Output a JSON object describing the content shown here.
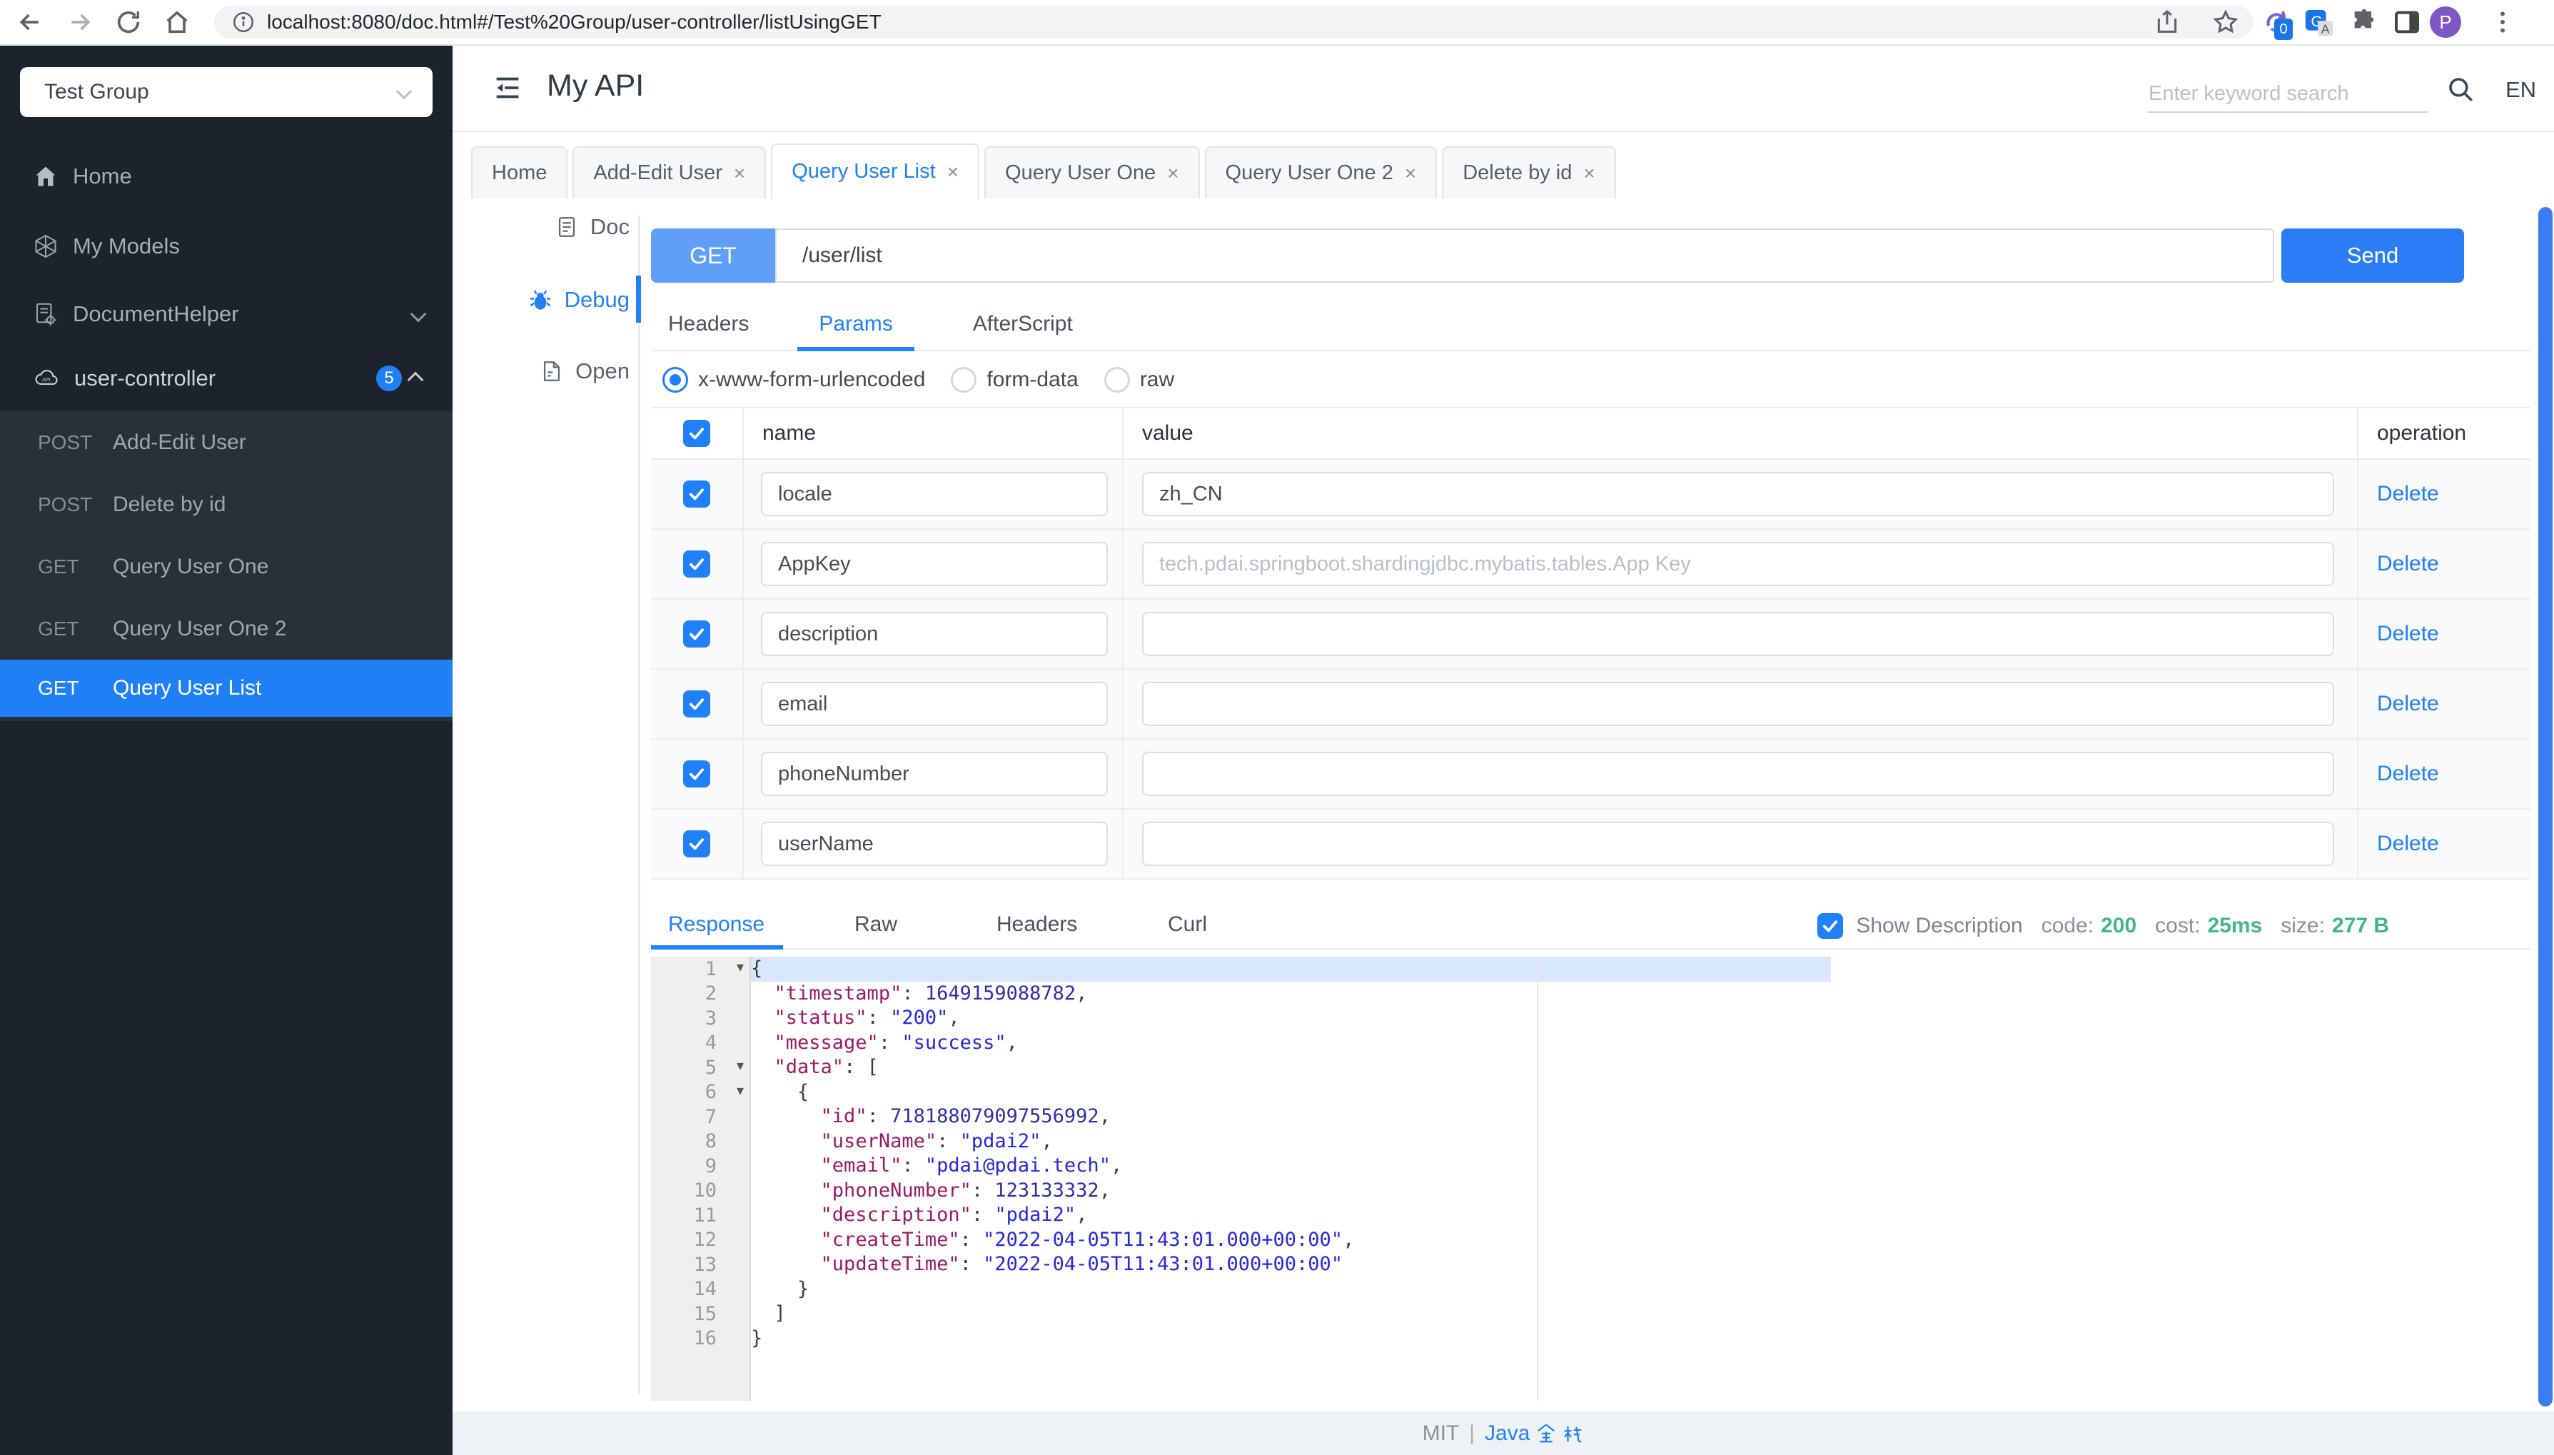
{
  "colors": {
    "accent": "#2080f7",
    "method_chip": "#5f9ff8",
    "success_green": "#42b983",
    "sidebar_bg": "#1c232d",
    "submenu_bg": "#28303a",
    "selected_item": "#1f7ff5",
    "json_key": "#991a66",
    "json_string": "#2727e0",
    "json_number": "#2f2fa8"
  },
  "browser": {
    "url": "localhost:8080/doc.html#/Test%20Group/user-controller/listUsingGET",
    "extension_badge": "0",
    "avatar_initial": "P"
  },
  "sidebar": {
    "group_select": {
      "value": "Test Group"
    },
    "items": [
      {
        "label": "Home"
      },
      {
        "label": "My Models"
      },
      {
        "label": "DocumentHelper"
      }
    ],
    "controller": {
      "label": "user-controller",
      "badge": "5"
    },
    "endpoints": [
      {
        "method": "POST",
        "label": "Add-Edit User",
        "active": false
      },
      {
        "method": "POST",
        "label": "Delete by id",
        "active": false
      },
      {
        "method": "GET",
        "label": "Query User One",
        "active": false
      },
      {
        "method": "GET",
        "label": "Query User One 2",
        "active": false
      },
      {
        "method": "GET",
        "label": "Query User List",
        "active": true
      }
    ]
  },
  "header": {
    "title": "My API",
    "search_placeholder": "Enter keyword search",
    "lang": "EN"
  },
  "tabs": [
    {
      "label": "Home",
      "closable": false,
      "active": false
    },
    {
      "label": "Add-Edit User",
      "closable": true,
      "active": false
    },
    {
      "label": "Query User List",
      "closable": true,
      "active": true
    },
    {
      "label": "Query User One",
      "closable": true,
      "active": false
    },
    {
      "label": "Query User One 2",
      "closable": true,
      "active": false
    },
    {
      "label": "Delete by id",
      "closable": true,
      "active": false
    }
  ],
  "rail": {
    "items": [
      {
        "label": "Doc",
        "active": false
      },
      {
        "label": "Debug",
        "active": true
      },
      {
        "label": "Open",
        "active": false
      }
    ]
  },
  "request": {
    "method": "GET",
    "url": "/user/list",
    "send_label": "Send"
  },
  "request_tabs": [
    {
      "label": "Headers",
      "active": false
    },
    {
      "label": "Params",
      "active": true
    },
    {
      "label": "AfterScript",
      "active": false
    }
  ],
  "body_types": [
    {
      "label": "x-www-form-urlencoded",
      "selected": true
    },
    {
      "label": "form-data",
      "selected": false
    },
    {
      "label": "raw",
      "selected": false
    }
  ],
  "params_table": {
    "columns": [
      "name",
      "value",
      "operation"
    ],
    "delete_label": "Delete",
    "rows": [
      {
        "checked": true,
        "name": "locale",
        "value": "zh_CN",
        "placeholder": ""
      },
      {
        "checked": true,
        "name": "AppKey",
        "value": "",
        "placeholder": "tech.pdai.springboot.shardingjdbc.mybatis.tables.App Key"
      },
      {
        "checked": true,
        "name": "description",
        "value": "",
        "placeholder": ""
      },
      {
        "checked": true,
        "name": "email",
        "value": "",
        "placeholder": ""
      },
      {
        "checked": true,
        "name": "phoneNumber",
        "value": "",
        "placeholder": ""
      },
      {
        "checked": true,
        "name": "userName",
        "value": "",
        "placeholder": ""
      }
    ]
  },
  "response": {
    "tabs": [
      {
        "label": "Response",
        "active": true
      },
      {
        "label": "Raw",
        "active": false
      },
      {
        "label": "Headers",
        "active": false
      },
      {
        "label": "Curl",
        "active": false
      }
    ],
    "show_description": {
      "label": "Show Description",
      "checked": true
    },
    "meta": [
      {
        "label": "code:",
        "value": "200"
      },
      {
        "label": "cost:",
        "value": "25ms"
      },
      {
        "label": "size:",
        "value": "277 B"
      }
    ]
  },
  "editor": {
    "lines": [
      {
        "n": 1,
        "fold": true,
        "active": true,
        "seg": [
          {
            "t": "p",
            "v": "{"
          }
        ]
      },
      {
        "n": 2,
        "seg": [
          {
            "t": "p",
            "v": "  "
          },
          {
            "t": "k",
            "v": "\"timestamp\""
          },
          {
            "t": "p",
            "v": ": "
          },
          {
            "t": "n",
            "v": "1649159088782"
          },
          {
            "t": "p",
            "v": ","
          }
        ]
      },
      {
        "n": 3,
        "seg": [
          {
            "t": "p",
            "v": "  "
          },
          {
            "t": "k",
            "v": "\"status\""
          },
          {
            "t": "p",
            "v": ": "
          },
          {
            "t": "s",
            "v": "\"200\""
          },
          {
            "t": "p",
            "v": ","
          }
        ]
      },
      {
        "n": 4,
        "seg": [
          {
            "t": "p",
            "v": "  "
          },
          {
            "t": "k",
            "v": "\"message\""
          },
          {
            "t": "p",
            "v": ": "
          },
          {
            "t": "s",
            "v": "\"success\""
          },
          {
            "t": "p",
            "v": ","
          }
        ]
      },
      {
        "n": 5,
        "fold": true,
        "seg": [
          {
            "t": "p",
            "v": "  "
          },
          {
            "t": "k",
            "v": "\"data\""
          },
          {
            "t": "p",
            "v": ": ["
          }
        ]
      },
      {
        "n": 6,
        "fold": true,
        "seg": [
          {
            "t": "p",
            "v": "    {"
          }
        ]
      },
      {
        "n": 7,
        "seg": [
          {
            "t": "p",
            "v": "      "
          },
          {
            "t": "k",
            "v": "\"id\""
          },
          {
            "t": "p",
            "v": ": "
          },
          {
            "t": "n",
            "v": "718188079097556992"
          },
          {
            "t": "p",
            "v": ","
          }
        ]
      },
      {
        "n": 8,
        "seg": [
          {
            "t": "p",
            "v": "      "
          },
          {
            "t": "k",
            "v": "\"userName\""
          },
          {
            "t": "p",
            "v": ": "
          },
          {
            "t": "s",
            "v": "\"pdai2\""
          },
          {
            "t": "p",
            "v": ","
          }
        ]
      },
      {
        "n": 9,
        "seg": [
          {
            "t": "p",
            "v": "      "
          },
          {
            "t": "k",
            "v": "\"email\""
          },
          {
            "t": "p",
            "v": ": "
          },
          {
            "t": "s",
            "v": "\"pdai@pdai.tech\""
          },
          {
            "t": "p",
            "v": ","
          }
        ]
      },
      {
        "n": 10,
        "seg": [
          {
            "t": "p",
            "v": "      "
          },
          {
            "t": "k",
            "v": "\"phoneNumber\""
          },
          {
            "t": "p",
            "v": ": "
          },
          {
            "t": "n",
            "v": "123133332"
          },
          {
            "t": "p",
            "v": ","
          }
        ]
      },
      {
        "n": 11,
        "seg": [
          {
            "t": "p",
            "v": "      "
          },
          {
            "t": "k",
            "v": "\"description\""
          },
          {
            "t": "p",
            "v": ": "
          },
          {
            "t": "s",
            "v": "\"pdai2\""
          },
          {
            "t": "p",
            "v": ","
          }
        ]
      },
      {
        "n": 12,
        "seg": [
          {
            "t": "p",
            "v": "      "
          },
          {
            "t": "k",
            "v": "\"createTime\""
          },
          {
            "t": "p",
            "v": ": "
          },
          {
            "t": "s",
            "v": "\"2022-04-05T11:43:01.000+00:00\""
          },
          {
            "t": "p",
            "v": ","
          }
        ]
      },
      {
        "n": 13,
        "seg": [
          {
            "t": "p",
            "v": "      "
          },
          {
            "t": "k",
            "v": "\"updateTime\""
          },
          {
            "t": "p",
            "v": ": "
          },
          {
            "t": "s",
            "v": "\"2022-04-05T11:43:01.000+00:00\""
          }
        ]
      },
      {
        "n": 14,
        "seg": [
          {
            "t": "p",
            "v": "    }"
          }
        ]
      },
      {
        "n": 15,
        "seg": [
          {
            "t": "p",
            "v": "  ]"
          }
        ]
      },
      {
        "n": 16,
        "seg": [
          {
            "t": "p",
            "v": "}"
          }
        ]
      }
    ]
  },
  "footer": {
    "license": "MIT",
    "separator": "|",
    "link": "Java 全栈",
    "link_latin": "Java"
  }
}
